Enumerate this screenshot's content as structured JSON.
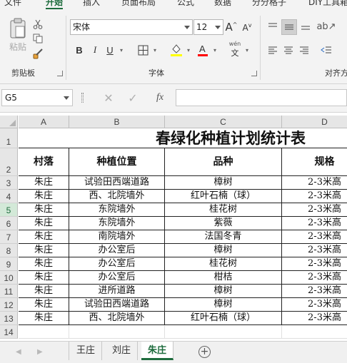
{
  "ribbon": {
    "menu_tabs": [
      "文件",
      "开始",
      "插入",
      "页面布局",
      "公式",
      "数据",
      "分分格子",
      "DIY工具箱"
    ],
    "clipboard": {
      "paste_label": "粘贴",
      "group_label": "剪贴板"
    },
    "font": {
      "name": "宋体",
      "size": "12",
      "group_label": "字体",
      "phonetic": "wén"
    },
    "alignment": {
      "group_label": "对齐方式"
    },
    "colors": {
      "accent": "#1e6c3d",
      "highlight": "#ffff00",
      "font_color": "#ff0000"
    }
  },
  "formula_bar": {
    "cell_ref": "G5",
    "value": ""
  },
  "sheet": {
    "columns": [
      "A",
      "B",
      "C",
      "D"
    ],
    "title": "春绿化种植计划统计表",
    "headers": [
      "村落",
      "种植位置",
      "品种",
      "规格"
    ],
    "rows": [
      {
        "num": "3",
        "village": "朱庄",
        "location": "试验田西端道路",
        "variety": "樟树",
        "spec": "2-3米高"
      },
      {
        "num": "4",
        "village": "朱庄",
        "location": "西、北院墙外",
        "variety": "红叶石楠（球）",
        "spec": "2-3米高"
      },
      {
        "num": "5",
        "village": "朱庄",
        "location": "东院墙外",
        "variety": "桂花树",
        "spec": "2-3米高"
      },
      {
        "num": "6",
        "village": "朱庄",
        "location": "东院墙外",
        "variety": "紫薇",
        "spec": "2-3米高"
      },
      {
        "num": "7",
        "village": "朱庄",
        "location": "南院墙外",
        "variety": "法国冬青",
        "spec": "2-3米高"
      },
      {
        "num": "8",
        "village": "朱庄",
        "location": "办公室后",
        "variety": "樟树",
        "spec": "2-3米高"
      },
      {
        "num": "9",
        "village": "朱庄",
        "location": "办公室后",
        "variety": "桂花树",
        "spec": "2-3米高"
      },
      {
        "num": "10",
        "village": "朱庄",
        "location": "办公室后",
        "variety": "柑桔",
        "spec": "2-3米高"
      },
      {
        "num": "11",
        "village": "朱庄",
        "location": "进所道路",
        "variety": "樟树",
        "spec": "2-3米高"
      },
      {
        "num": "12",
        "village": "朱庄",
        "location": "试验田西端道路",
        "variety": "樟树",
        "spec": "2-3米高"
      },
      {
        "num": "13",
        "village": "朱庄",
        "location": "西、北院墙外",
        "variety": "红叶石楠（球）",
        "spec": "2-3米高"
      }
    ],
    "extra_rows": [
      "1",
      "2",
      "14"
    ]
  },
  "sheet_tabs": [
    "王庄",
    "刘庄",
    "朱庄"
  ]
}
